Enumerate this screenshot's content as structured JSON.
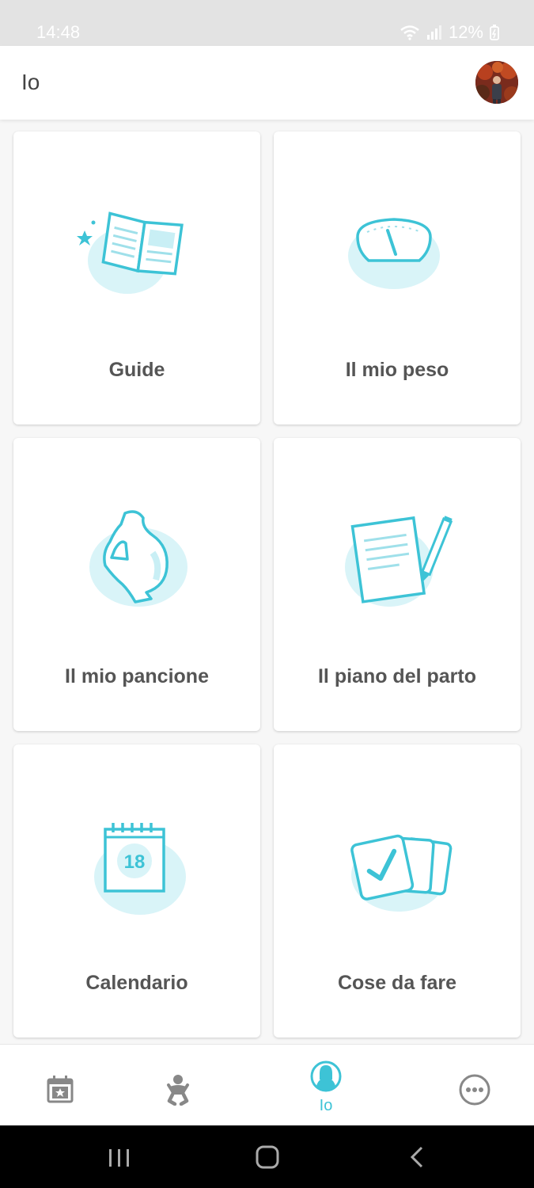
{
  "status_bar": {
    "time": "14:48",
    "battery": "12%"
  },
  "header": {
    "title": "Io"
  },
  "cards": [
    {
      "label": "Guide",
      "icon": "open-book-icon"
    },
    {
      "label": "Il mio peso",
      "icon": "scale-icon"
    },
    {
      "label": "Il mio pancione",
      "icon": "pregnant-belly-icon"
    },
    {
      "label": "Il piano del parto",
      "icon": "document-pencil-icon"
    },
    {
      "label": "Calendario",
      "icon": "calendar-icon",
      "calendar_day": "18"
    },
    {
      "label": "Cose da fare",
      "icon": "checklist-cards-icon"
    }
  ],
  "bottom_nav": {
    "items": [
      {
        "icon": "calendar-star-icon",
        "label": ""
      },
      {
        "icon": "baby-icon",
        "label": ""
      },
      {
        "icon": "user-icon",
        "label": "Io",
        "active": true
      },
      {
        "icon": "more-icon",
        "label": ""
      }
    ]
  },
  "colors": {
    "accent": "#3dc3d6",
    "accent_light": "#d9f4f8"
  }
}
